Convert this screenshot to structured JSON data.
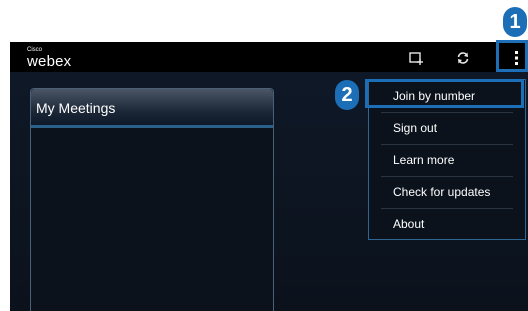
{
  "app": {
    "brand_small": "Cisco",
    "brand_main": "webex"
  },
  "actionbar": {
    "icons": [
      "new-meeting-icon",
      "refresh-icon",
      "overflow-menu-icon"
    ]
  },
  "panel": {
    "title": "My Meetings"
  },
  "menu": {
    "items": [
      {
        "label": "Join by number"
      },
      {
        "label": "Sign out"
      },
      {
        "label": "Learn more"
      },
      {
        "label": "Check for updates"
      },
      {
        "label": "About"
      }
    ]
  },
  "callouts": {
    "step1": "1",
    "step2": "2"
  },
  "colors": {
    "accent": "#1c6fb6",
    "background": "#0b121c",
    "actionbar": "#000000"
  }
}
